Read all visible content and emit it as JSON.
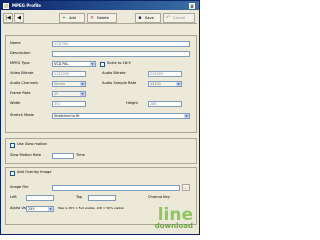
{
  "window": {
    "title": "MPEG Profile"
  },
  "toolbar": {
    "nav_first": "|◀",
    "nav_prev": "◀",
    "add_label": "Add",
    "delete_label": "Delete",
    "save_label": "Save",
    "cancel_label": "Cancel"
  },
  "profile": {
    "name_label": "Name",
    "name_value": "VCD PAL",
    "description_label": "Description",
    "description_value": "",
    "mpeg_type_label": "MPEG Type",
    "mpeg_type_value": "VCD PAL",
    "scale_label": "Scale to 16:9",
    "video_bitrate_label": "Video Bitrate",
    "video_bitrate_value": "1152000",
    "audio_bitrate_label": "Audio Bitrate",
    "audio_bitrate_value": "224000",
    "audio_channels_label": "Audio Channels",
    "audio_channels_value": "Stereo",
    "audio_sample_rate_label": "Audio Sample Rate",
    "audio_sample_rate_value": "44100",
    "frame_rate_label": "Frame Rate",
    "frame_rate_value": "25",
    "width_label": "Width",
    "width_value": "352",
    "height_label": "Height",
    "height_value": "288",
    "stretch_mode_label": "Stretch Mode",
    "stretch_mode_value": "Stretched to fit"
  },
  "slow_motion": {
    "use_label": "Use Slow motion",
    "rate_label": "Slow Motion Rate",
    "rate_value": "",
    "times_label": "Time"
  },
  "overlay": {
    "add_label": "Add Overlay Image",
    "image_file_label": "Image File",
    "image_file_value": "",
    "left_label": "Left",
    "left_value": "",
    "top_label": "Top",
    "top_value": "",
    "chroma_key_label": "Chroma Key",
    "alpha_label": "Alpha Value",
    "alpha_value": "255",
    "alpha_hint": "Max is 255 = Full visible, 128 = 50% visible"
  },
  "watermark": {
    "line1": "line",
    "line2": "download"
  }
}
